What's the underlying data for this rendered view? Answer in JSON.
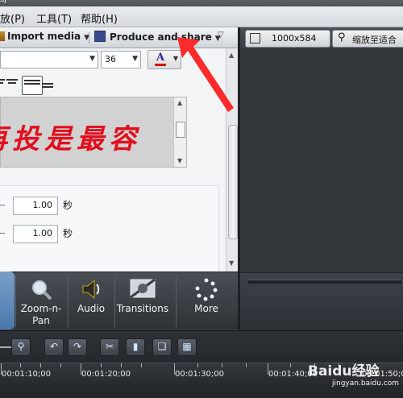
{
  "titlebar": {
    "fragment": "sj"
  },
  "menu": {
    "items": [
      "放(P)",
      "工具(T)",
      "帮助(H)"
    ]
  },
  "toolbar": {
    "import_label": "Import media",
    "produce_label": "Produce and share",
    "extra_caret": "▽"
  },
  "text_props": {
    "font_name": "",
    "font_size": "36",
    "text_content": "再投是最容",
    "text_color": "#e10f1e",
    "value1": "1.00",
    "value2": "1.00",
    "unit1": "秒",
    "unit2": "秒"
  },
  "tabs": [
    {
      "label": "ts"
    },
    {
      "label": "Zoom-n-Pan"
    },
    {
      "label": "Audio"
    },
    {
      "label": "Transitions"
    },
    {
      "label": "More"
    }
  ],
  "preview_toolbar": {
    "size_label": "1000x584",
    "zoom_label": "缩放至适合"
  },
  "timeline": {
    "times": [
      "00:01:10;00",
      "00:01:20;00",
      "00:01:30;00",
      "00:01:40;00",
      "00:01:50;00"
    ]
  },
  "watermark": {
    "brand": "Baidu经验",
    "url": "jingyan.baidu.com"
  },
  "colors": {
    "accent_red": "#e10f1e",
    "active_tab": "#5a86b8"
  }
}
